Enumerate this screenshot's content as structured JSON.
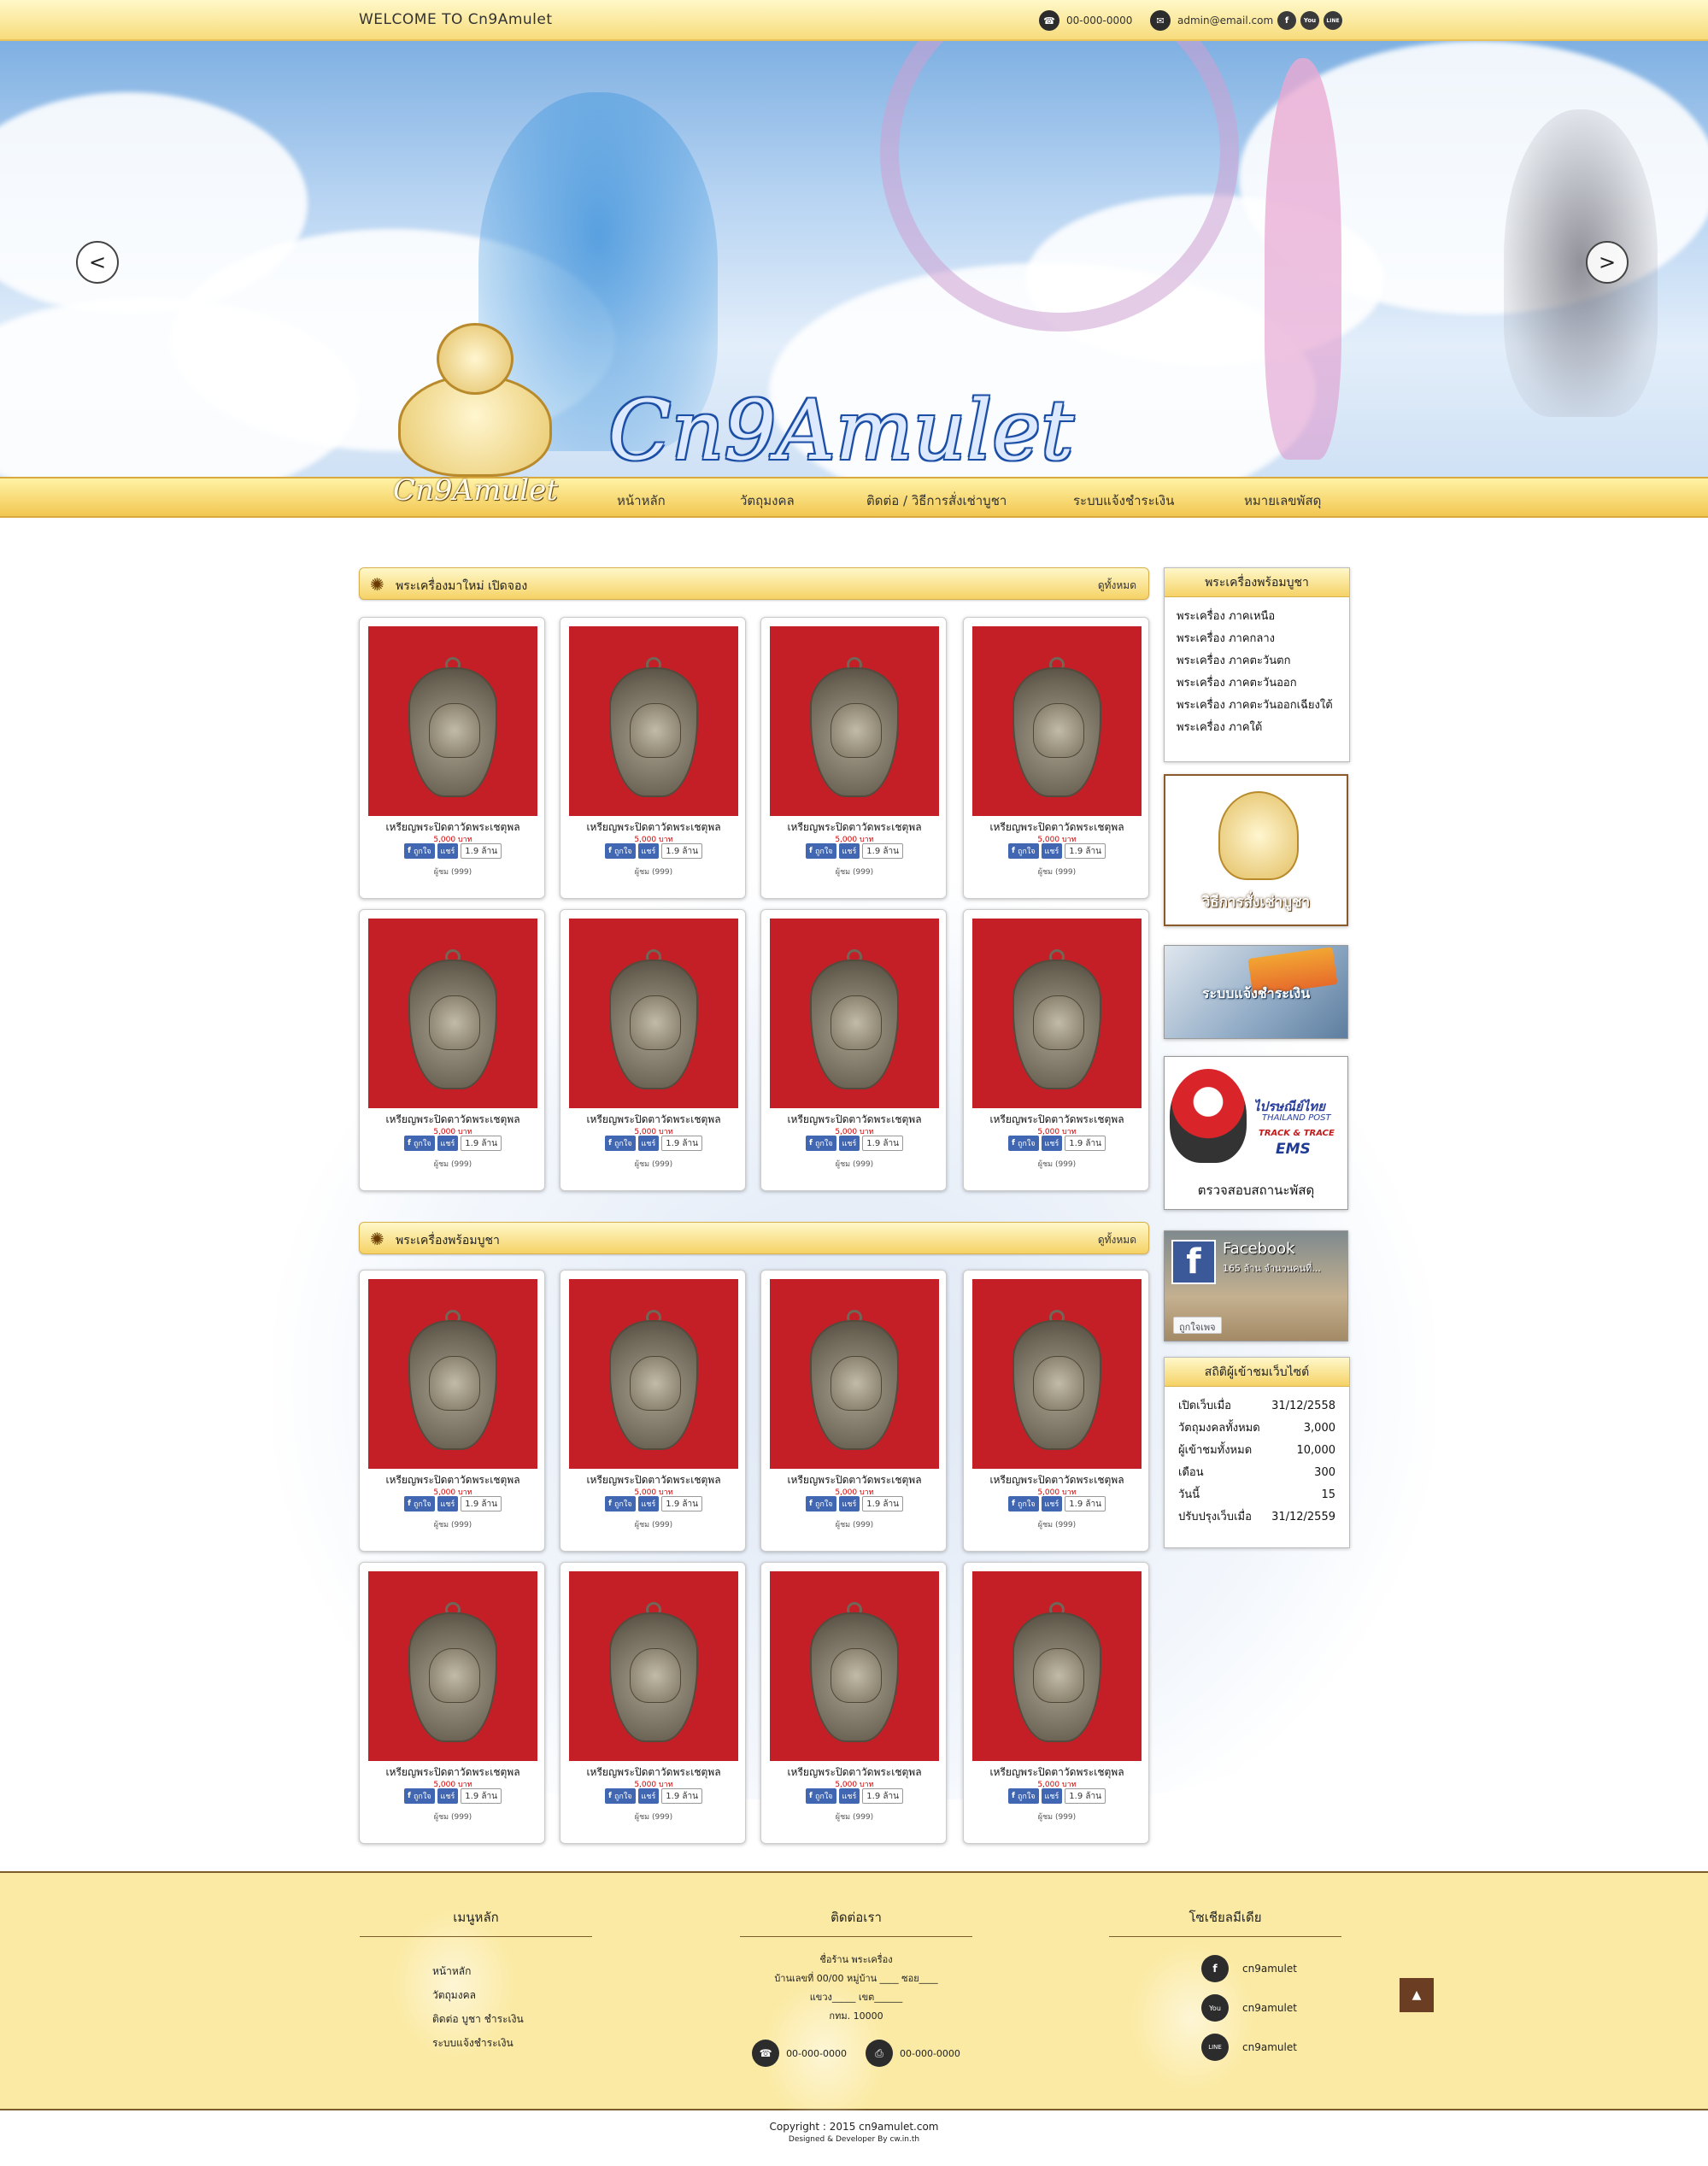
{
  "topbar": {
    "welcome": "WELCOME  TO  Cn9Amulet",
    "phone": "00-000-0000",
    "email": "admin@email.com",
    "social": [
      "f",
      "You",
      "LINE"
    ]
  },
  "hero": {
    "brand": "Cn9Amulet",
    "prev": "<",
    "next": ">"
  },
  "logo": {
    "text": "Cn9Amulet"
  },
  "nav": [
    "หน้าหลัก",
    "วัตถุมงคล",
    "ติดต่อ / วิธีการสั่งเช่าบูชา",
    "ระบบแจ้งชำระเงิน",
    "หมายเลขพัสดุ"
  ],
  "sections": [
    {
      "title": "พระเครื่องมาใหม่  เปิดจอง",
      "more": "ดูทั้งหมด"
    },
    {
      "title": "พระเครื่องพร้อมบูชา",
      "more": "ดูทั้งหมด"
    }
  ],
  "product": {
    "name": "เหรียญพระปิดตาวัดพระเชตุพล",
    "price": "5,000 บาท",
    "like": "ถูกใจ",
    "share": "แชร์",
    "count": "1.9 ล้าน",
    "views": "ผู้ชม (999)"
  },
  "sidebar": {
    "title": "พระเครื่องพร้อมบูชา",
    "items": [
      "พระเครื่อง ภาคเหนือ",
      "พระเครื่อง ภาคกลาง",
      "พระเครื่อง ภาคตะวันตก",
      "พระเครื่อง ภาคตะวันออก",
      "พระเครื่อง ภาคตะวันออกเฉียงใต้",
      "พระเครื่อง ภาคใต้"
    ],
    "order_banner": "วิธีการสั่งเช่าบูชา",
    "payment_banner": "ระบบแจ้งชำระเงิน",
    "post_brand": "ไปรษณีย์ไทย",
    "post_sub": "THAILAND POST",
    "track": "TRACK & TRACE",
    "ems": "EMS",
    "post_caption": "ตรวจสอบสถานะพัสดุ",
    "fb_title": "Facebook",
    "fb_sub": "165 ล้าน จำนวนคนที่...",
    "fb_like": "ถูกใจเพจ",
    "stats_title": "สถิติผู้เข้าชมเว็บไซต์",
    "stats": [
      {
        "label": "เปิดเว็บเมื่อ",
        "value": "31/12/2558"
      },
      {
        "label": "วัตถุมงคลทั้งหมด",
        "value": "3,000"
      },
      {
        "label": "ผู้เข้าชมทั้งหมด",
        "value": "10,000"
      },
      {
        "label": "เดือน",
        "value": "300"
      },
      {
        "label": "วันนี้",
        "value": "15"
      },
      {
        "label": "ปรับปรุงเว็บเมื่อ",
        "value": "31/12/2559"
      }
    ]
  },
  "footer": {
    "menu_title": "เมนูหลัก",
    "menu": [
      "หน้าหลัก",
      "วัตถุมงคล",
      "ติดต่อ บูชา ชำระเงิน",
      "ระบบแจ้งชำระเงิน"
    ],
    "contact_title": "ติดต่อเรา",
    "address": [
      "ชื่อร้าน  พระเครื่อง",
      "บ้านเลขที่ 00/00 หมู่บ้าน ____ ซอย____",
      "แขวง_____ เขต______",
      "กทม. 10000"
    ],
    "phone": "00-000-0000",
    "fax": "00-000-0000",
    "social_title": "โซเชียลมีเดีย",
    "social": [
      {
        "icon": "f",
        "name": "cn9amulet"
      },
      {
        "icon": "You",
        "name": "cn9amulet"
      },
      {
        "icon": "LINE",
        "name": "cn9amulet"
      }
    ],
    "totop": "▲"
  },
  "copyright": "Copyright  :  2015  cn9amulet.com",
  "credit": "Designed & Developer By cw.in.th"
}
